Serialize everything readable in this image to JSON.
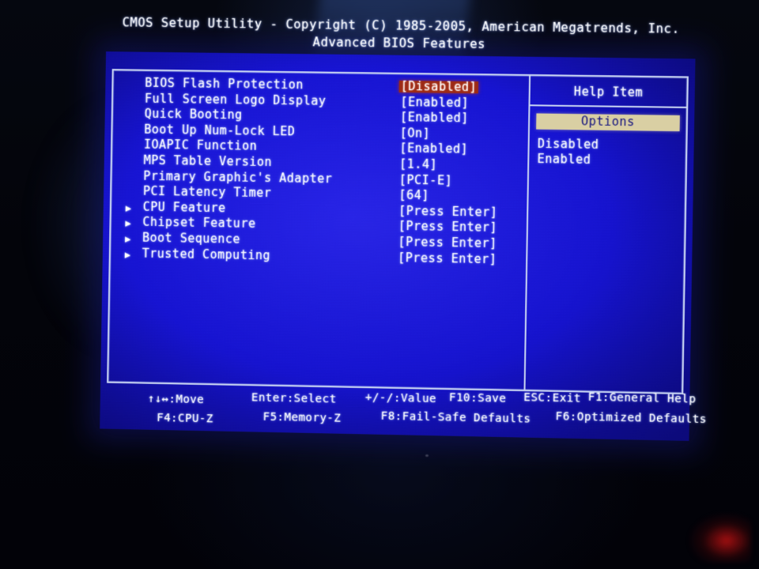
{
  "screen": {
    "title_line1": "CMOS Setup Utility - Copyright (C) 1985-2005, American Megatrends, Inc.",
    "title_line2": "Advanced BIOS Features"
  },
  "settings": {
    "rows": [
      {
        "arrow": "",
        "label": "BIOS Flash Protection",
        "value": "[Disabled]",
        "selected": true
      },
      {
        "arrow": "",
        "label": "Full Screen Logo Display",
        "value": "[Enabled]",
        "selected": false
      },
      {
        "arrow": "",
        "label": "Quick Booting",
        "value": "[Enabled]",
        "selected": false
      },
      {
        "arrow": "",
        "label": "Boot Up Num-Lock LED",
        "value": "[On]",
        "selected": false
      },
      {
        "arrow": "",
        "label": "IOAPIC Function",
        "value": "[Enabled]",
        "selected": false
      },
      {
        "arrow": "",
        "label": "MPS Table Version",
        "value": "[1.4]",
        "selected": false
      },
      {
        "arrow": "",
        "label": "Primary Graphic's Adapter",
        "value": "[PCI-E]",
        "selected": false
      },
      {
        "arrow": "",
        "label": "PCI Latency Timer",
        "value": "[64]",
        "selected": false
      },
      {
        "arrow": "▶",
        "label": "CPU Feature",
        "value": "[Press Enter]",
        "selected": false
      },
      {
        "arrow": "▶",
        "label": "Chipset Feature",
        "value": "[Press Enter]",
        "selected": false
      },
      {
        "arrow": "▶",
        "label": "Boot Sequence",
        "value": "[Press Enter]",
        "selected": false
      },
      {
        "arrow": "▶",
        "label": "Trusted Computing",
        "value": "[Press Enter]",
        "selected": false
      }
    ]
  },
  "help": {
    "title": "Help Item",
    "options_header": "Options",
    "options": [
      "Disabled",
      "Enabled"
    ]
  },
  "footer": {
    "move": "↑↓↔:Move",
    "enter_select": "Enter:Select",
    "value": "+/-/:Value",
    "save": "F10:Save",
    "exit": "ESC:Exit",
    "general_help": "F1:General Help",
    "cpuz": "F4:CPU-Z",
    "memoryz": "F5:Memory-Z",
    "failsafe": "F8:Fail-Safe Defaults",
    "optimized": "F6:Optimized Defaults"
  },
  "colors": {
    "screen_blue": "#1512d6",
    "border_light": "#c8d4f2",
    "highlight_red": "#9c2a16",
    "options_tan": "#d9cfa3",
    "options_text": "#13127f",
    "text_white": "#ffffff"
  }
}
